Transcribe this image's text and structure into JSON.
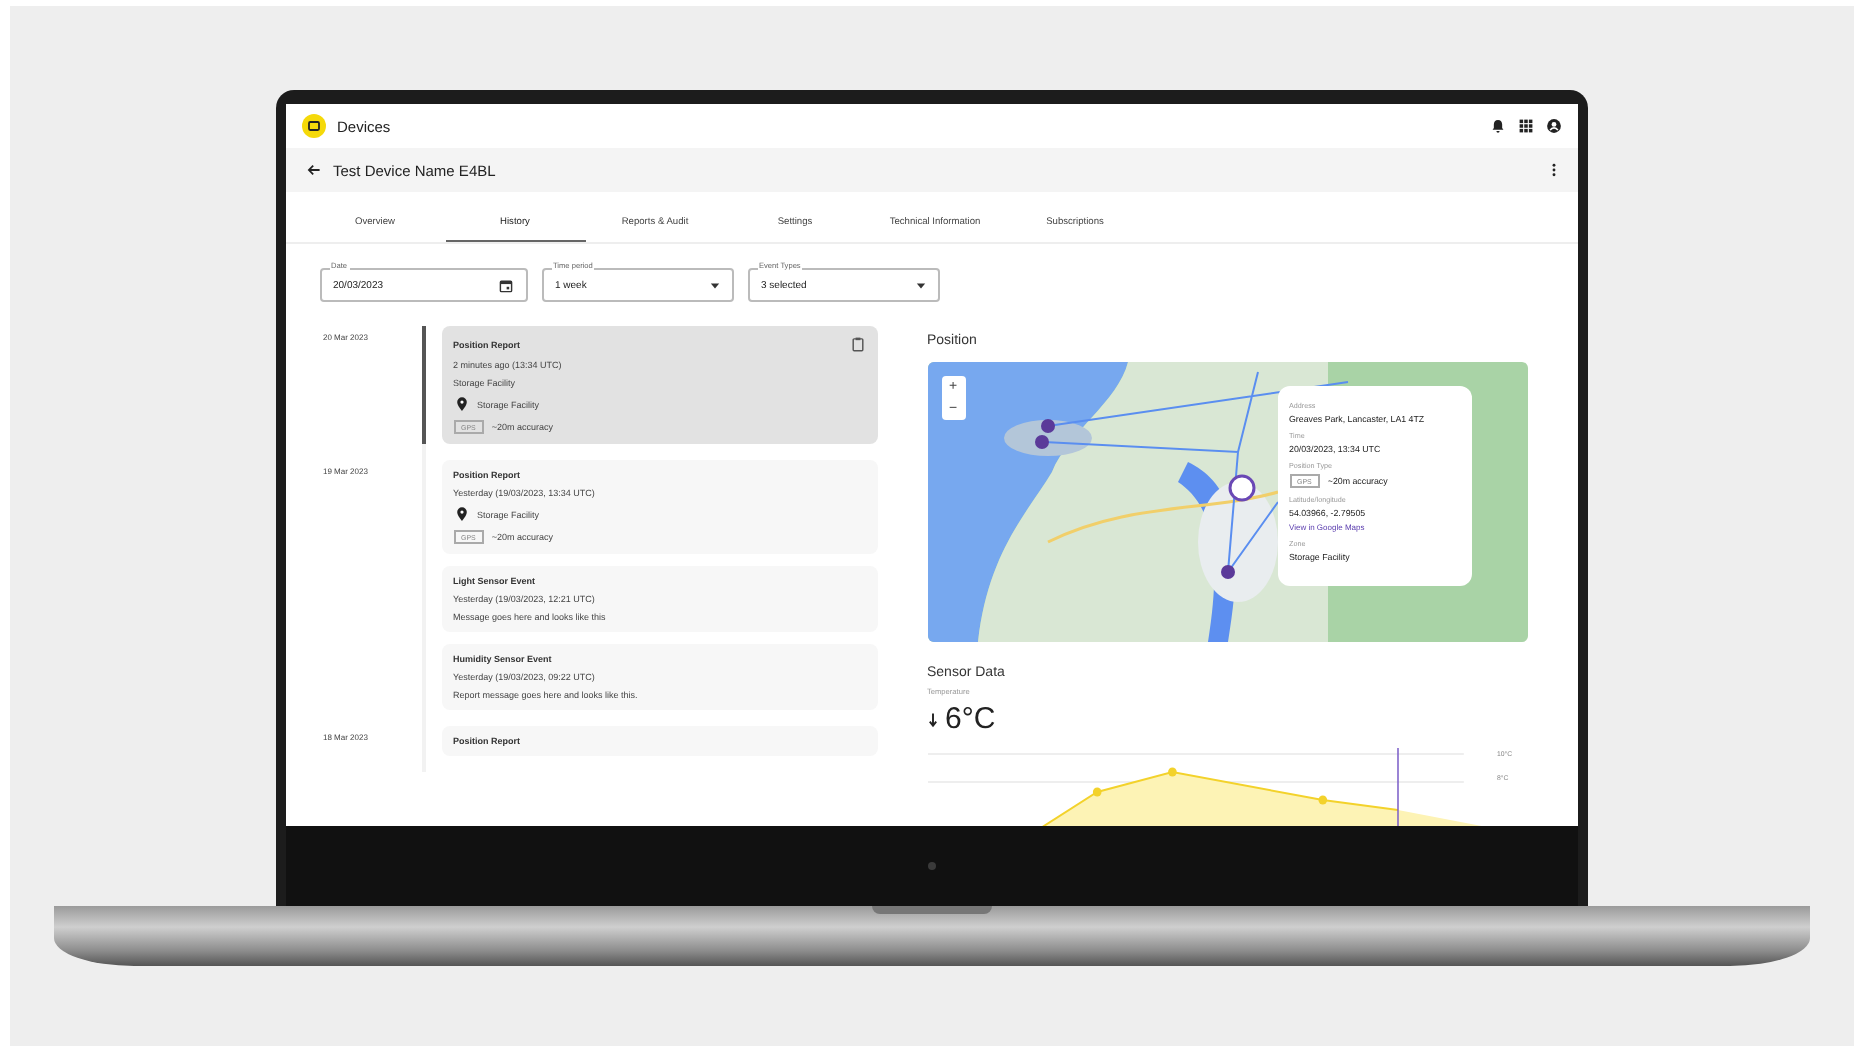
{
  "app_bar": {
    "title": "Devices"
  },
  "device": {
    "title": "Test Device Name E4BL"
  },
  "tabs": [
    {
      "label": "Overview",
      "selected": false
    },
    {
      "label": "History",
      "selected": true
    },
    {
      "label": "Reports & Audit",
      "selected": false
    },
    {
      "label": "Settings",
      "selected": false
    },
    {
      "label": "Technical Information",
      "selected": false
    },
    {
      "label": "Subscriptions",
      "selected": false
    }
  ],
  "filters": [
    {
      "label": "Date",
      "value": "20/03/2023",
      "kind": "date"
    },
    {
      "label": "Time period",
      "value": "1 week",
      "kind": "select"
    },
    {
      "label": "Event Types",
      "value": "3 selected",
      "kind": "select"
    }
  ],
  "timeline": [
    {
      "date": "20 Mar 2023",
      "events": [
        {
          "kind": "position",
          "selected": true,
          "title": "Position Report",
          "time": "2 minutes ago (13:34 UTC)",
          "zone": "Storage Facility",
          "location": "Storage Facility",
          "badge": "GPS",
          "accuracy": "~20m accuracy"
        }
      ]
    },
    {
      "date": "19 Mar 2023",
      "events": [
        {
          "kind": "position",
          "selected": false,
          "title": "Position Report",
          "time": "Yesterday (19/03/2023, 13:34 UTC)",
          "location": "Storage Facility",
          "badge": "GPS",
          "accuracy": "~20m accuracy"
        },
        {
          "kind": "message",
          "selected": false,
          "title": "Light Sensor Event",
          "time": "Yesterday (19/03/2023, 12:21 UTC)",
          "message": "Message goes here and looks like this"
        },
        {
          "kind": "message",
          "selected": false,
          "title": "Humidity Sensor Event",
          "time": "Yesterday (19/03/2023, 09:22 UTC)",
          "message": "Report message goes here and looks like this."
        }
      ]
    },
    {
      "date": "18 Mar 2023",
      "events": [
        {
          "kind": "position",
          "selected": false,
          "title": "Position Report"
        }
      ]
    }
  ],
  "position": {
    "heading": "Position",
    "zoom_in": "+",
    "zoom_out": "−",
    "popup": [
      {
        "label": "Address",
        "value": "Greaves Park, Lancaster, LA1 4TZ"
      },
      {
        "label": "Time",
        "value": "20/03/2023, 13:34 UTC"
      },
      {
        "label": "Position Type",
        "badge": "GPS",
        "value": "~20m accuracy"
      },
      {
        "label": "Latitude/longitude",
        "value": "54.03966, -2.79505",
        "link": "View in Google Maps"
      },
      {
        "label": "Zone",
        "value": "Storage Facility"
      }
    ]
  },
  "sensor_data": {
    "heading": "Sensor Data",
    "label": "Temperature",
    "reading": "6°C",
    "ticks": [
      "10°C",
      "8°C"
    ]
  }
}
